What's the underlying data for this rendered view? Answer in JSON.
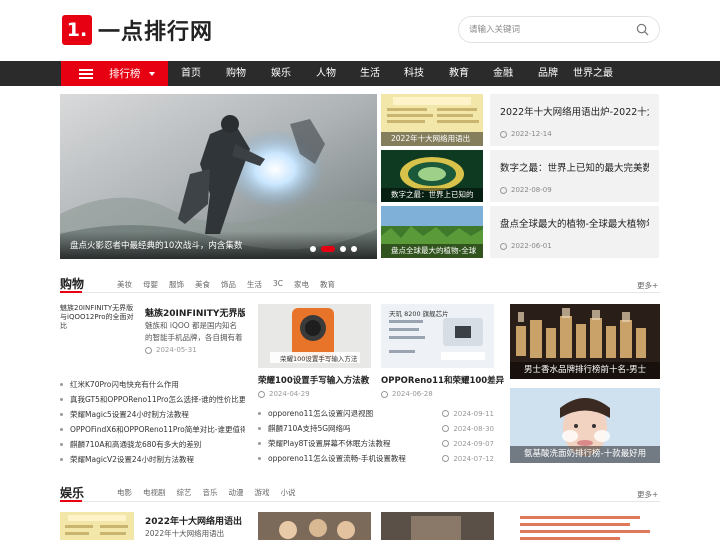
{
  "brand": {
    "logo_mark": "1.",
    "name": "一点排行网",
    "accent": "#e60012"
  },
  "search": {
    "placeholder": "请输入关键词"
  },
  "nav": {
    "rank_label": "排行榜",
    "items": [
      "首页",
      "购物",
      "娱乐",
      "人物",
      "生活",
      "科技",
      "教育",
      "金融",
      "品牌",
      "世界之最"
    ]
  },
  "hero": {
    "caption": "盘点火影忍者中最经典的10次战斗，内含集数",
    "active_dot": 2,
    "dot_count": 4
  },
  "thumbs": [
    "2022年十大网络用语出",
    "数字之最：世界上已知的",
    "盘点全球最大的植物-全球"
  ],
  "news": [
    {
      "title": "2022年十大网络用语出炉-2022十大",
      "date": "2022-12-14"
    },
    {
      "title": "数字之最：世界上已知的最大完美数",
      "date": "2022-08-09"
    },
    {
      "title": "盘点全球最大的植物-全球最大植物年",
      "date": "2022-06-01"
    }
  ],
  "shopping": {
    "title": "购物",
    "tags": [
      "美妆",
      "母婴",
      "服饰",
      "美食",
      "饰品",
      "生活",
      "3C",
      "家电",
      "教育"
    ],
    "more": "更多+",
    "feature": {
      "img_alt": "魅族20INFINITY无界版与iQOO12Pro的全面对比",
      "title": "魅族20INFINITY无界版与",
      "desc": "魅族和 iQOO 都是国内知名的智能手机品牌，各自拥有着自",
      "date": "2024-05-31"
    },
    "list": [
      "红米K70Pro闪电快充有什么作用",
      "真我GT5和OPPOReno11Pro怎么选择-谁的性价比更高",
      "荣耀Magic5设置24小时制方法教程",
      "OPPOFindX6和OPPOReno11Pro简单对比-谁更值得入",
      "麒麟710A和高通骁龙680有多大的差别",
      "荣耀MagicV2设置24小时制方法教程"
    ],
    "cards": [
      {
        "title": "荣耀100设置手写输入方法教",
        "date": "2024-04-29",
        "img_text": "荣耀100设置手写输入方法"
      },
      {
        "title": "OPPOReno11和荣耀100差异",
        "date": "2024-06-28",
        "img_text": "天玑 8200 旗舰芯片"
      }
    ],
    "list2": [
      {
        "text": "opporeno11怎么设置闪退视图",
        "date": "2024-09-11"
      },
      {
        "text": "麒麟710A支持5G网络吗",
        "date": "2024-08-30"
      },
      {
        "text": "荣耀Play8T设置屏幕不休眠方法教程",
        "date": "2024-09-07"
      },
      {
        "text": "opporeno11怎么设置流畅-手机设置教程",
        "date": "2024-07-12"
      }
    ],
    "side": [
      "男士香水品牌排行榜前十名-男士",
      "氨基酸洗面奶排行榜-十款最好用"
    ]
  },
  "ent": {
    "title": "娱乐",
    "tags": [
      "电影",
      "电视剧",
      "综艺",
      "音乐",
      "动漫",
      "游戏",
      "小说"
    ],
    "more": "更多+",
    "feature_title": "2022年十大网络用语出",
    "feature_sub": "2022年十大网络用语出"
  }
}
